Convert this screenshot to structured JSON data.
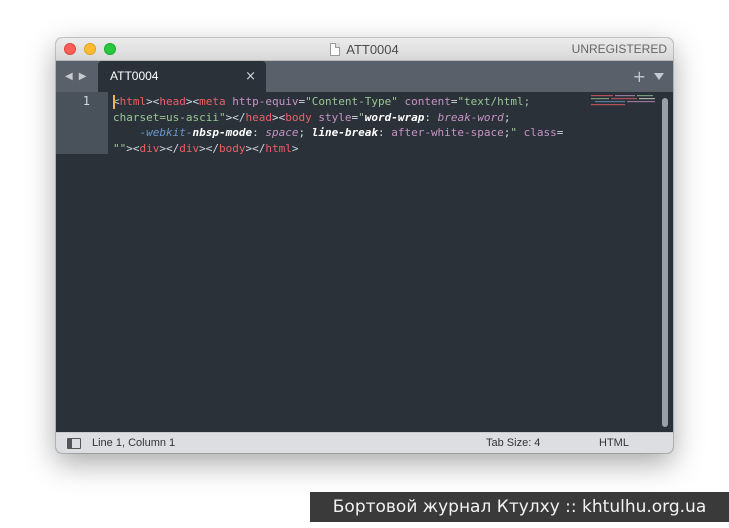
{
  "window": {
    "title": "ATT0004",
    "license_status": "UNREGISTERED"
  },
  "tabs": [
    {
      "label": "ATT0004",
      "close_glyph": "×",
      "active": true
    }
  ],
  "tab_tools": {
    "add_glyph": "+"
  },
  "editor": {
    "line_numbers": [
      "1"
    ],
    "code_tokens": [
      {
        "t": "<",
        "c": "punc"
      },
      {
        "t": "html",
        "c": "tag"
      },
      {
        "t": "><",
        "c": "punc"
      },
      {
        "t": "head",
        "c": "tag"
      },
      {
        "t": "><",
        "c": "punc"
      },
      {
        "t": "meta",
        "c": "tag"
      },
      {
        "t": " ",
        "c": "punc"
      },
      {
        "t": "http-equiv",
        "c": "attr"
      },
      {
        "t": "=",
        "c": "punc"
      },
      {
        "t": "\"Content-Type\"",
        "c": "str"
      },
      {
        "t": " ",
        "c": "punc"
      },
      {
        "t": "content",
        "c": "attr"
      },
      {
        "t": "=",
        "c": "punc"
      },
      {
        "t": "\"text/html;",
        "c": "str"
      },
      {
        "t": "\n",
        "c": "punc"
      },
      {
        "t": "charset=us-ascii\"",
        "c": "str"
      },
      {
        "t": "></",
        "c": "punc"
      },
      {
        "t": "head",
        "c": "tag"
      },
      {
        "t": "><",
        "c": "punc"
      },
      {
        "t": "body",
        "c": "tag"
      },
      {
        "t": " ",
        "c": "punc"
      },
      {
        "t": "style",
        "c": "attr"
      },
      {
        "t": "=",
        "c": "punc"
      },
      {
        "t": "\"",
        "c": "str"
      },
      {
        "t": "word-wrap",
        "c": "prop-b"
      },
      {
        "t": ": ",
        "c": "punc"
      },
      {
        "t": "break-word",
        "c": "val"
      },
      {
        "t": ";",
        "c": "punc"
      },
      {
        "t": "\n    ",
        "c": "punc"
      },
      {
        "t": "-webkit-",
        "c": "vendor"
      },
      {
        "t": "nbsp-mode",
        "c": "prop-b"
      },
      {
        "t": ": ",
        "c": "punc"
      },
      {
        "t": "space",
        "c": "val"
      },
      {
        "t": "; ",
        "c": "punc"
      },
      {
        "t": "line-break",
        "c": "prop-b"
      },
      {
        "t": ": ",
        "c": "punc"
      },
      {
        "t": "after-white-space",
        "c": "attr"
      },
      {
        "t": ";",
        "c": "punc"
      },
      {
        "t": "\"",
        "c": "str"
      },
      {
        "t": " ",
        "c": "punc"
      },
      {
        "t": "class",
        "c": "attr"
      },
      {
        "t": "=",
        "c": "punc"
      },
      {
        "t": "\n",
        "c": "punc"
      },
      {
        "t": "\"\"",
        "c": "str"
      },
      {
        "t": "><",
        "c": "punc"
      },
      {
        "t": "div",
        "c": "tag"
      },
      {
        "t": "></",
        "c": "punc"
      },
      {
        "t": "div",
        "c": "tag"
      },
      {
        "t": "></",
        "c": "punc"
      },
      {
        "t": "body",
        "c": "tag"
      },
      {
        "t": "></",
        "c": "punc"
      },
      {
        "t": "html",
        "c": "tag"
      },
      {
        "t": ">",
        "c": "punc"
      }
    ]
  },
  "status_bar": {
    "position": "Line 1, Column 1",
    "tab_size": "Tab Size: 4",
    "syntax": "HTML"
  },
  "watermark": "Бортовой журнал Ктулху :: khtulhu.org.ua",
  "colors": {
    "editor_bg": "#2b3139",
    "tab_bar_bg": "#596069",
    "tag": "#ec5f67",
    "attribute": "#c594c5",
    "string": "#99c794",
    "vendor_prefix": "#6699cc",
    "cursor": "#f9ae58"
  }
}
